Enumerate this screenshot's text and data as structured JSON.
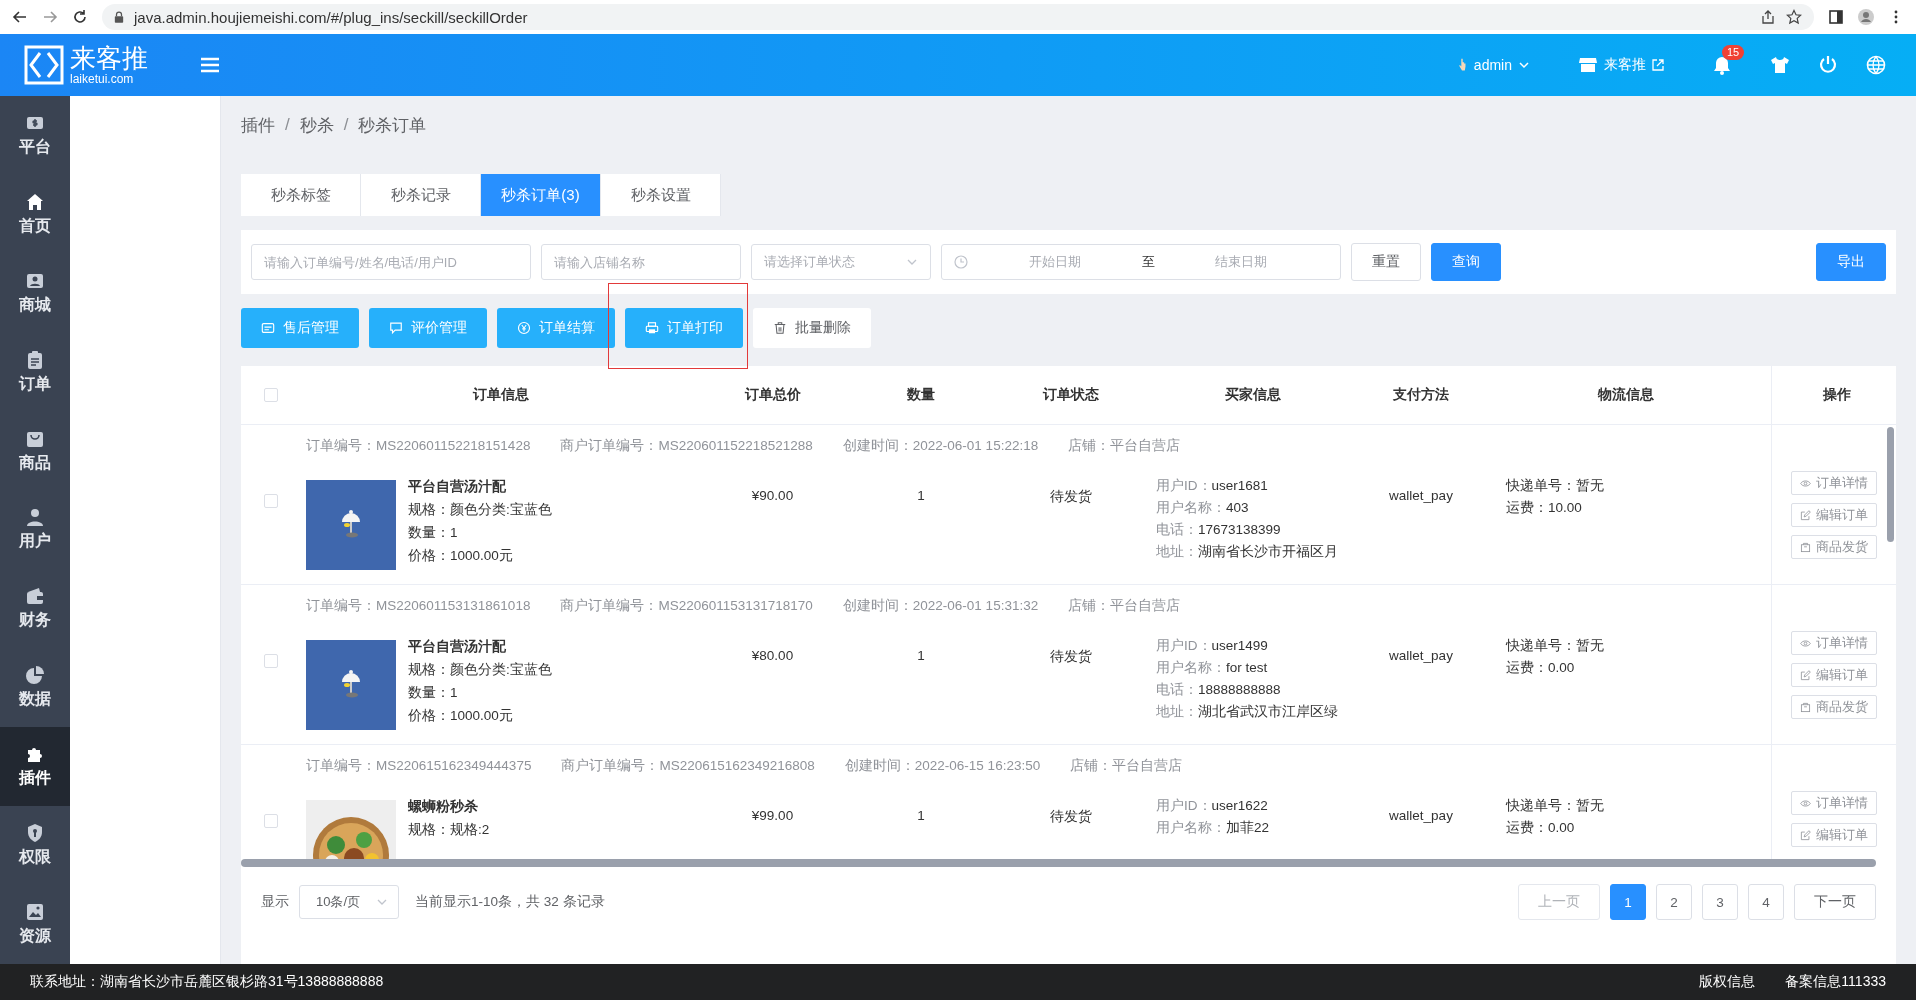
{
  "browser": {
    "url": "java.admin.houjiemeishi.com/#/plug_ins/seckill/seckillOrder"
  },
  "header": {
    "logo_text": "来客推",
    "logo_sub": "laiketui.com",
    "user": "admin",
    "store": "来客推",
    "notifications": "15"
  },
  "sidebar": {
    "items": [
      {
        "label": "平台",
        "selected": false
      },
      {
        "label": "首页",
        "selected": false
      },
      {
        "label": "商城",
        "selected": false
      },
      {
        "label": "订单",
        "selected": false
      },
      {
        "label": "商品",
        "selected": false
      },
      {
        "label": "用户",
        "selected": false
      },
      {
        "label": "财务",
        "selected": false
      },
      {
        "label": "数据",
        "selected": false
      },
      {
        "label": "插件",
        "selected": true
      },
      {
        "label": "权限",
        "selected": false
      },
      {
        "label": "资源",
        "selected": false
      }
    ]
  },
  "breadcrumb": {
    "items": [
      "插件",
      "秒杀",
      "秒杀订单"
    ],
    "separator": "/"
  },
  "tabs": [
    {
      "label": "秒杀标签",
      "selected": false
    },
    {
      "label": "秒杀记录",
      "selected": false
    },
    {
      "label": "秒杀订单(3)",
      "selected": true
    },
    {
      "label": "秒杀设置",
      "selected": false
    }
  ],
  "filters": {
    "order_placeholder": "请输入订单编号/姓名/电话/用户ID",
    "store_placeholder": "请输入店铺名称",
    "status_placeholder": "请选择订单状态",
    "start_placeholder": "开始日期",
    "range_sep": "至",
    "end_placeholder": "结束日期",
    "reset": "重置",
    "query": "查询",
    "export": "导出"
  },
  "actions": [
    {
      "label": "售后管理",
      "highlighted": false
    },
    {
      "label": "评价管理",
      "highlighted": false
    },
    {
      "label": "订单结算",
      "highlighted": false
    },
    {
      "label": "订单打印",
      "highlighted": true
    },
    {
      "label": "批量删除",
      "highlighted": false
    }
  ],
  "table": {
    "select_all_checked": false,
    "columns": [
      "订单信息",
      "订单总价",
      "数量",
      "订单状态",
      "买家信息",
      "支付方法",
      "物流信息",
      "操作"
    ],
    "rows": [
      {
        "checked": false,
        "order_no": "订单编号：MS220601152218151428",
        "merchant_no": "商户订单编号：MS220601152218521288",
        "created": "创建时间：2022-06-01 15:22:18",
        "store": "店铺：平台自营店",
        "name": "平台自营汤汁配",
        "spec": "规格：颜色分类:宝蓝色",
        "qty_line": "数量：1",
        "price_line": "价格：1000.00元",
        "total": "¥90.00",
        "qty": "1",
        "status": "待发货",
        "buyer": [
          {
            "label": "用户ID：",
            "value": "user1681"
          },
          {
            "label": "用户名称：",
            "value": "403"
          },
          {
            "label": "电话：",
            "value": "17673138399"
          },
          {
            "label": "地址：",
            "value": "湖南省长沙市开福区月"
          }
        ],
        "payment": "wallet_pay",
        "logistics": [
          {
            "label": "快递单号：",
            "value": "暂无"
          },
          {
            "label": "运费：",
            "value": "10.00"
          }
        ],
        "ops": [
          "订单详情",
          "编辑订单",
          "商品发货"
        ]
      },
      {
        "checked": false,
        "order_no": "订单编号：MS220601153131861018",
        "merchant_no": "商户订单编号：MS220601153131718170",
        "created": "创建时间：2022-06-01 15:31:32",
        "store": "店铺：平台自营店",
        "name": "平台自营汤汁配",
        "spec": "规格：颜色分类:宝蓝色",
        "qty_line": "数量：1",
        "price_line": "价格：1000.00元",
        "total": "¥80.00",
        "qty": "1",
        "status": "待发货",
        "buyer": [
          {
            "label": "用户ID：",
            "value": "user1499"
          },
          {
            "label": "用户名称：",
            "value": "for test"
          },
          {
            "label": "电话：",
            "value": "18888888888"
          },
          {
            "label": "地址：",
            "value": "湖北省武汉市江岸区绿"
          }
        ],
        "payment": "wallet_pay",
        "logistics": [
          {
            "label": "快递单号：",
            "value": "暂无"
          },
          {
            "label": "运费：",
            "value": "0.00"
          }
        ],
        "ops": [
          "订单详情",
          "编辑订单",
          "商品发货"
        ]
      },
      {
        "checked": false,
        "order_no": "订单编号：MS220615162349444375",
        "merchant_no": "商户订单编号：MS220615162349216808",
        "created": "创建时间：2022-06-15 16:23:50",
        "store": "店铺：平台自营店",
        "name": "螺蛳粉秒杀",
        "spec": "规格：规格:2",
        "total": "¥99.00",
        "qty": "1",
        "status": "待发货",
        "buyer": [
          {
            "label": "用户ID：",
            "value": "user1622"
          },
          {
            "label": "用户名称：",
            "value": "加菲22"
          }
        ],
        "payment": "wallet_pay",
        "logistics": [
          {
            "label": "快递单号：",
            "value": "暂无"
          },
          {
            "label": "运费：",
            "value": "0.00"
          }
        ],
        "ops": [
          "订单详情",
          "编辑订单"
        ]
      }
    ]
  },
  "pagination": {
    "show_label": "显示",
    "page_size": "10条/页",
    "summary": "当前显示1-10条，共 32 条记录",
    "prev": {
      "label": "上一页",
      "disabled": true
    },
    "pages": [
      {
        "label": "1",
        "selected": true
      },
      {
        "label": "2",
        "selected": false
      },
      {
        "label": "3",
        "selected": false
      },
      {
        "label": "4",
        "selected": false
      }
    ],
    "next": {
      "label": "下一页",
      "disabled": false
    }
  },
  "footer": {
    "contact": "联系地址：湖南省长沙市岳麓区银杉路31号13888888888",
    "links": [
      "版权信息",
      "备案信息111333"
    ]
  }
}
